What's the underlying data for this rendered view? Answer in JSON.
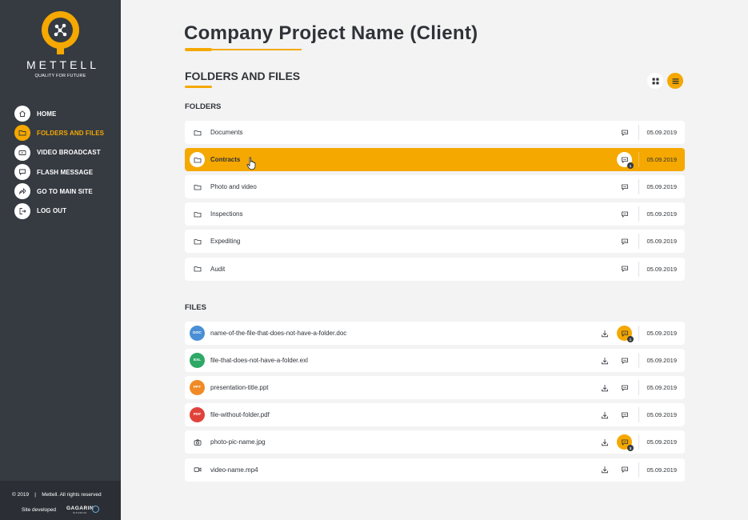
{
  "sidebar": {
    "brand": "METTELL",
    "tagline": "QUALITY FOR FUTURE",
    "nav": [
      {
        "label": "HOME",
        "icon": "home-icon",
        "active": false
      },
      {
        "label": "FOLDERS AND FILES",
        "icon": "folder-icon",
        "active": true
      },
      {
        "label": "VIDEO BROADCAST",
        "icon": "video-icon",
        "active": false
      },
      {
        "label": "FLASH MESSAGE",
        "icon": "message-icon",
        "active": false
      },
      {
        "label": "GO TO MAIN SITE",
        "icon": "share-icon",
        "active": false
      },
      {
        "label": "LOG OUT",
        "icon": "logout-icon",
        "active": false
      }
    ],
    "footer": {
      "copyright": "© 2019    |    Mettell. All rights reserved",
      "developed": "Site developed",
      "studio": "GAGARIN",
      "studio_sub": "STUDIO"
    }
  },
  "main": {
    "title": "Company Project Name (Client)",
    "section": "FOLDERS AND FILES",
    "folders_label": "FOLDERS",
    "files_label": "FILES",
    "folders": [
      {
        "name": "Documents",
        "date": "05.09.2019",
        "badge": "",
        "active": false
      },
      {
        "name": "Contracts",
        "date": "05.09.2019",
        "badge": "1",
        "active": true
      },
      {
        "name": "Photo and video",
        "date": "05.09.2019",
        "badge": "",
        "active": false
      },
      {
        "name": "Inspections",
        "date": "05.09.2019",
        "badge": "",
        "active": false
      },
      {
        "name": "Expediting",
        "date": "05.09.2019",
        "badge": "",
        "active": false
      },
      {
        "name": "Audit",
        "date": "05.09.2019",
        "badge": "",
        "active": false
      }
    ],
    "files": [
      {
        "name": "name-of-the-file-that-does-not-have-a-folder.doc",
        "type": "DOC",
        "color": "#4a8fd6",
        "date": "05.09.2019",
        "badge": "1"
      },
      {
        "name": "file-that-does-not-have-a-folder.exl",
        "type": "EXL",
        "color": "#2ea866",
        "date": "05.09.2019",
        "badge": ""
      },
      {
        "name": "presentation-title.ppt",
        "type": "PPT",
        "color": "#f08a24",
        "date": "05.09.2019",
        "badge": ""
      },
      {
        "name": "file-without-folder.pdf",
        "type": "PDF",
        "color": "#e0423a",
        "date": "05.09.2019",
        "badge": ""
      },
      {
        "name": "photo-pic-name.jpg",
        "type": "",
        "icon": "camera-icon",
        "date": "05.09.2019",
        "badge": "3"
      },
      {
        "name": "video-name.mp4",
        "type": "",
        "icon": "video-icon",
        "date": "05.09.2019",
        "badge": ""
      }
    ]
  },
  "colors": {
    "accent": "#f5a800",
    "sidebar": "#363b42",
    "text": "#2f3338"
  }
}
